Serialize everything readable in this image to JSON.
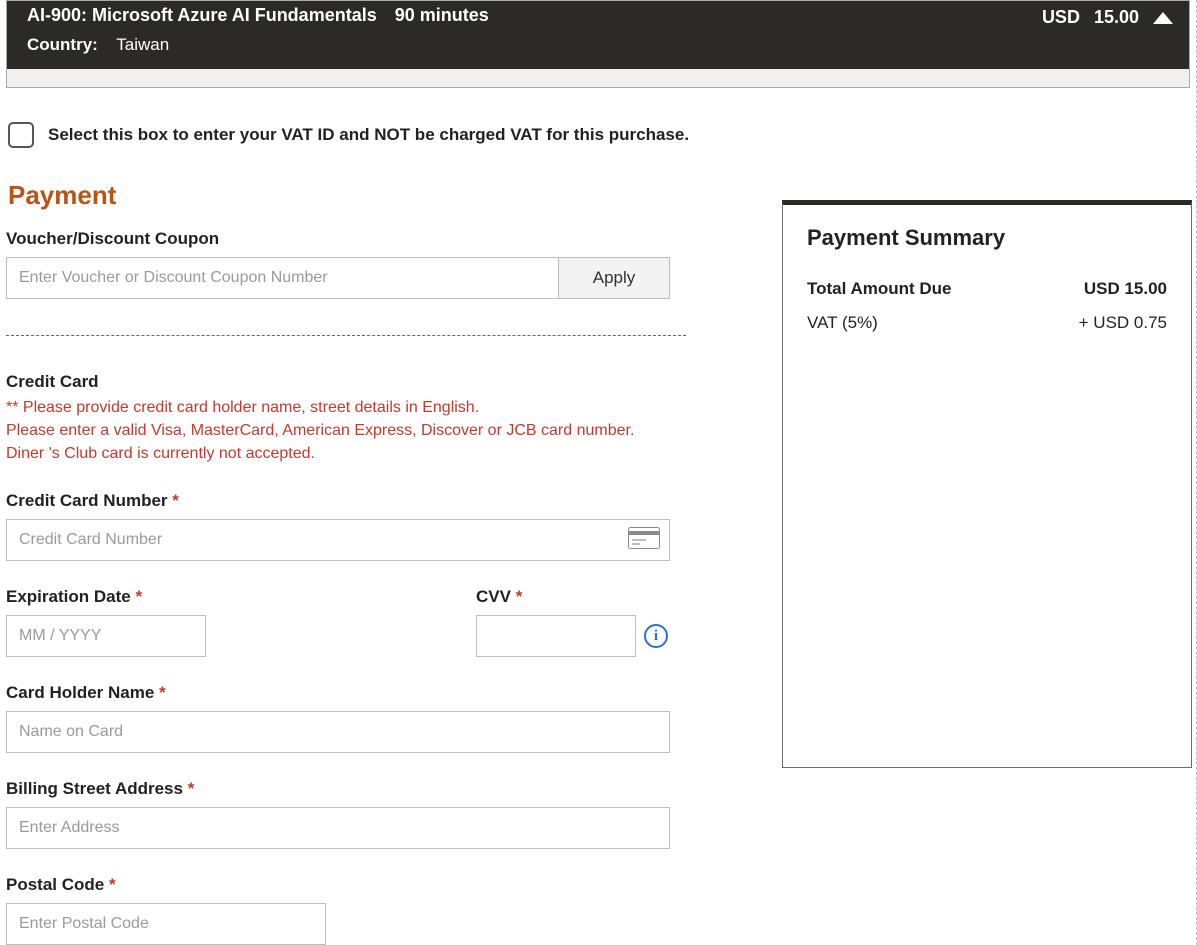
{
  "exam": {
    "title": "AI-900: Microsoft Azure AI Fundamentals",
    "duration": "90 minutes",
    "country_label": "Country:",
    "country_value": "Taiwan",
    "currency": "USD",
    "price": "15.00"
  },
  "vat_checkbox_label": "Select this box to enter your VAT ID and NOT be charged VAT for this purchase.",
  "payment_heading": "Payment",
  "voucher": {
    "label": "Voucher/Discount Coupon",
    "placeholder": "Enter Voucher or Discount Coupon Number",
    "apply_label": "Apply"
  },
  "credit_card": {
    "section_title": "Credit Card",
    "note1": "** Please provide credit card holder name, street details in English.",
    "note2": "Please enter a valid Visa, MasterCard, American Express, Discover or JCB card number.",
    "note3": "Diner 's Club card is currently not accepted.",
    "number_label": "Credit Card Number",
    "number_placeholder": "Credit Card Number",
    "expiry_label": "Expiration Date",
    "expiry_placeholder": "MM / YYYY",
    "cvv_label": "CVV",
    "holder_label": "Card Holder Name",
    "holder_placeholder": "Name on Card",
    "address_label": "Billing Street Address",
    "address_placeholder": "Enter Address",
    "postal_label": "Postal Code",
    "postal_placeholder": "Enter Postal Code"
  },
  "required_mark": "*",
  "summary": {
    "title": "Payment Summary",
    "total_label": "Total Amount Due",
    "total_value": "USD 15.00",
    "vat_label": "VAT (5%)",
    "vat_value": "+ USD 0.75"
  }
}
